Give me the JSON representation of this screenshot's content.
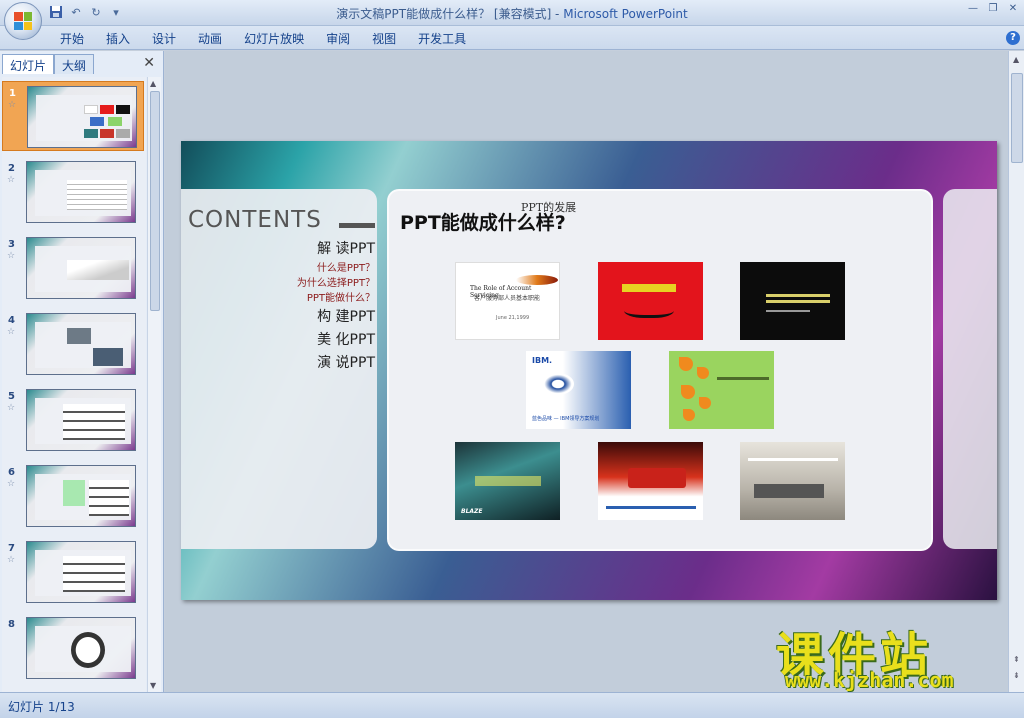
{
  "window": {
    "title": "演示文稿PPT能做成什么样？ [兼容模式] - ",
    "app_name": "Microsoft PowerPoint"
  },
  "ribbon": {
    "tabs": [
      "开始",
      "插入",
      "设计",
      "动画",
      "幻灯片放映",
      "审阅",
      "视图",
      "开发工具"
    ]
  },
  "left_pane": {
    "tabs": [
      "幻灯片",
      "大纲"
    ],
    "close": "✕",
    "thumbnails": [
      "1",
      "2",
      "3",
      "4",
      "5",
      "6",
      "7",
      "8"
    ],
    "selected_index": 1
  },
  "slide": {
    "contents_title": "CONTENTS",
    "toc": [
      {
        "text": "解 读PPT",
        "level": "main"
      },
      {
        "text": "什么是PPT？",
        "level": "sub"
      },
      {
        "text": "为什么选择PPT？",
        "level": "sub"
      },
      {
        "text": "PPT能做什么？",
        "level": "sub"
      },
      {
        "text": "构 建PPT",
        "level": "main"
      },
      {
        "text": "美 化PPT",
        "level": "main"
      },
      {
        "text": "演 说PPT",
        "level": "main"
      }
    ],
    "subtitle": "PPT的发展",
    "heading": "PPT能做成什么样?",
    "shots": {
      "account_title": "The Role of Account Servicing",
      "account_sub": "客户服务部人员基本职能",
      "account_date": "June 21,1999",
      "ibm": "IBM.",
      "ibm_caption": "蓝色品味 — IBM领导方案规划",
      "blue_caption": "BLAZE"
    }
  },
  "watermark": {
    "main": "课件站",
    "url": "www.kjzhan.com"
  },
  "status": {
    "slide_counter": "幻灯片 1/13"
  }
}
